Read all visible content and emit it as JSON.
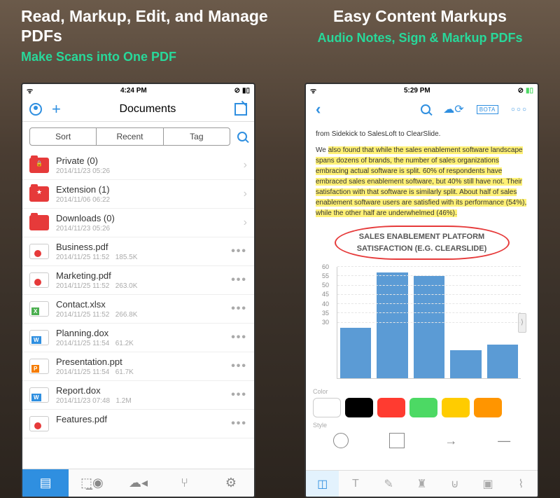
{
  "promo": {
    "left_title": "Read, Markup, Edit, and Manage PDFs",
    "left_sub": "Make Scans into One PDF",
    "right_title": "Easy Content Markups",
    "right_sub": "Audio Notes, Sign & Markup PDFs"
  },
  "left": {
    "status_time": "4:24 PM",
    "nav_title": "Documents",
    "seg": {
      "sort": "Sort",
      "recent": "Recent",
      "tag": "Tag"
    },
    "folders": [
      {
        "name": "Private (0)",
        "date": "2014/11/23 05:26",
        "icon": "folder-red-lock"
      },
      {
        "name": "Extension (1)",
        "date": "2014/11/06 06:22",
        "icon": "folder-red-star"
      },
      {
        "name": "Downloads (0)",
        "date": "2014/11/23 05:26",
        "icon": "folder-red"
      }
    ],
    "files": [
      {
        "name": "Business.pdf",
        "date": "2014/11/25 11:52",
        "size": "185.5K",
        "icon": "file-pdf"
      },
      {
        "name": "Marketing.pdf",
        "date": "2014/11/25 11:52",
        "size": "263.0K",
        "icon": "file-pdf"
      },
      {
        "name": "Contact.xlsx",
        "date": "2014/11/25 11:52",
        "size": "266.8K",
        "icon": "file-xls"
      },
      {
        "name": "Planning.dox",
        "date": "2014/11/25 11:54",
        "size": "61.2K",
        "icon": "file-doc"
      },
      {
        "name": "Presentation.ppt",
        "date": "2014/11/25 11:54",
        "size": "61.7K",
        "icon": "file-ppt"
      },
      {
        "name": "Report.dox",
        "date": "2014/11/23 07:48",
        "size": "1.2M",
        "icon": "file-doc"
      },
      {
        "name": "Features.pdf",
        "date": "",
        "size": "",
        "icon": "file-pdf"
      }
    ]
  },
  "right": {
    "status_time": "5:29 PM",
    "toolbar": {
      "bota": "BOTA"
    },
    "doc": {
      "line1": "from Sidekick to SalesLoft to ClearSlide.",
      "para": "We also found that while the sales enablement software landscape spans dozens of brands, the number of sales organizations embracing actual software is split. 60% of respondents have embraced sales enablement software, but 40% still have not. Their satisfaction with that software is similarly split. About half of sales enablement software users are satisfied with its performance (54%), while the other half are underwhelmed (46%).",
      "chart_title_l1": "SALES ENABLEMENT PLATFORM",
      "chart_title_l2": "SATISFACTION (E.G. CLEARSLIDE)"
    },
    "panel": {
      "color_label": "Color",
      "style_label": "Style"
    },
    "colors": [
      "#ffffff",
      "#000000",
      "#ff3b30",
      "#4cd964",
      "#ffcc00",
      "#ff9500"
    ]
  },
  "chart_data": {
    "type": "bar",
    "categories": [
      "",
      "",
      "",
      "",
      ""
    ],
    "values": [
      27,
      57,
      55,
      15,
      18
    ],
    "title": "SALES ENABLEMENT PLATFORM SATISFACTION (E.G. CLEARSLIDE)",
    "xlabel": "",
    "ylabel": "",
    "ylim": [
      0,
      60
    ],
    "yticks": [
      30,
      35,
      40,
      45,
      50,
      55,
      60
    ]
  }
}
